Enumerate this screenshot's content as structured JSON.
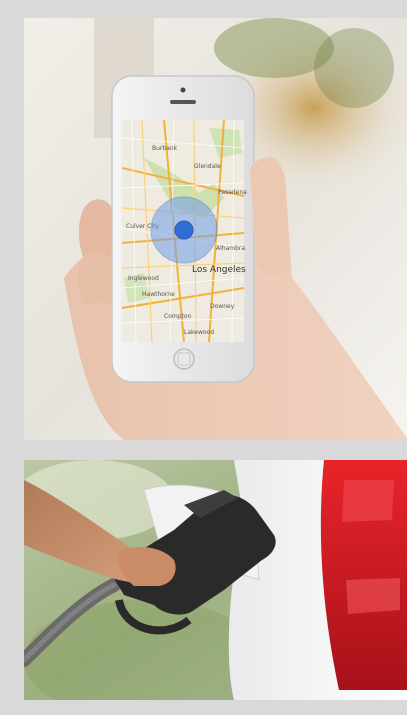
{
  "photos": [
    {
      "subject": "hand-holding-phone-map"
    },
    {
      "subject": "fuel-nozzle-car"
    }
  ],
  "phone_map": {
    "city_label": "Los Angeles",
    "labels": [
      "Burbank",
      "Glendale",
      "Pasadena",
      "Alhambra",
      "Downey",
      "Inglewood",
      "Compton",
      "Culver City",
      "Lakewood",
      "Hawthorne"
    ]
  },
  "colors": {
    "page_bg": "#d9d9d9",
    "location_dot": "#2f6fd4",
    "accuracy_circle": "#6f9ee8",
    "taillight": "#c0141c"
  }
}
